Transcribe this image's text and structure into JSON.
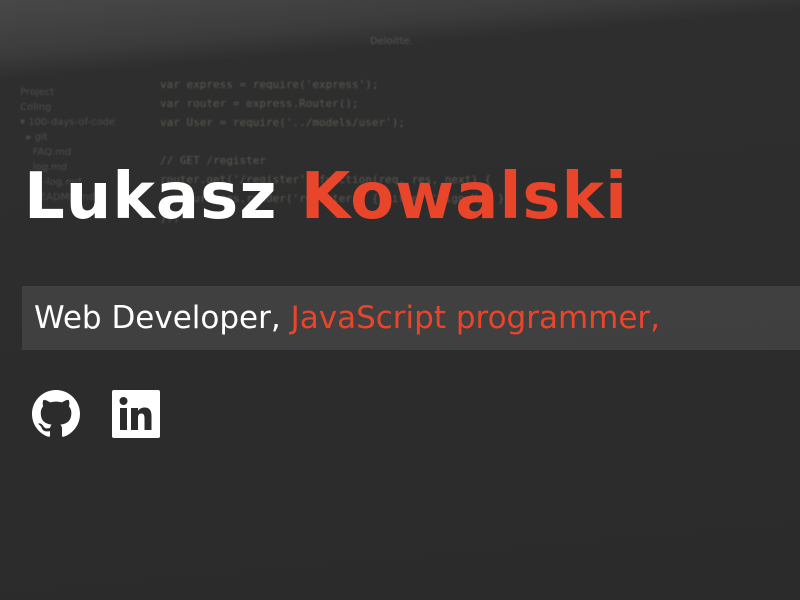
{
  "background": {
    "window_title": "Deloitte.",
    "sidebar": "Project\nColing\n▾ 100-days-of-code\n  ▸ git\n    FAQ.md\n    log.md\n    r1-log.md\n    README.md",
    "code": "var express = require('express');\nvar router = express.Router();\nvar User = require('../models/user');\n\n// GET /register\nrouter.get('/register', function(req, res, next) {\n  return res.render('register', { title: 'Sign Up' });\n});"
  },
  "hero": {
    "first_name": "Lukasz",
    "last_name": "Kowalski",
    "tagline_plain": "Web Developer,",
    "tagline_accent": "JavaScript programmer,"
  },
  "social": [
    {
      "icon": "github-icon"
    },
    {
      "icon": "linkedin-icon"
    }
  ],
  "colors": {
    "accent": "#e8452b",
    "text": "#ffffff",
    "background": "#2b2b2b"
  }
}
